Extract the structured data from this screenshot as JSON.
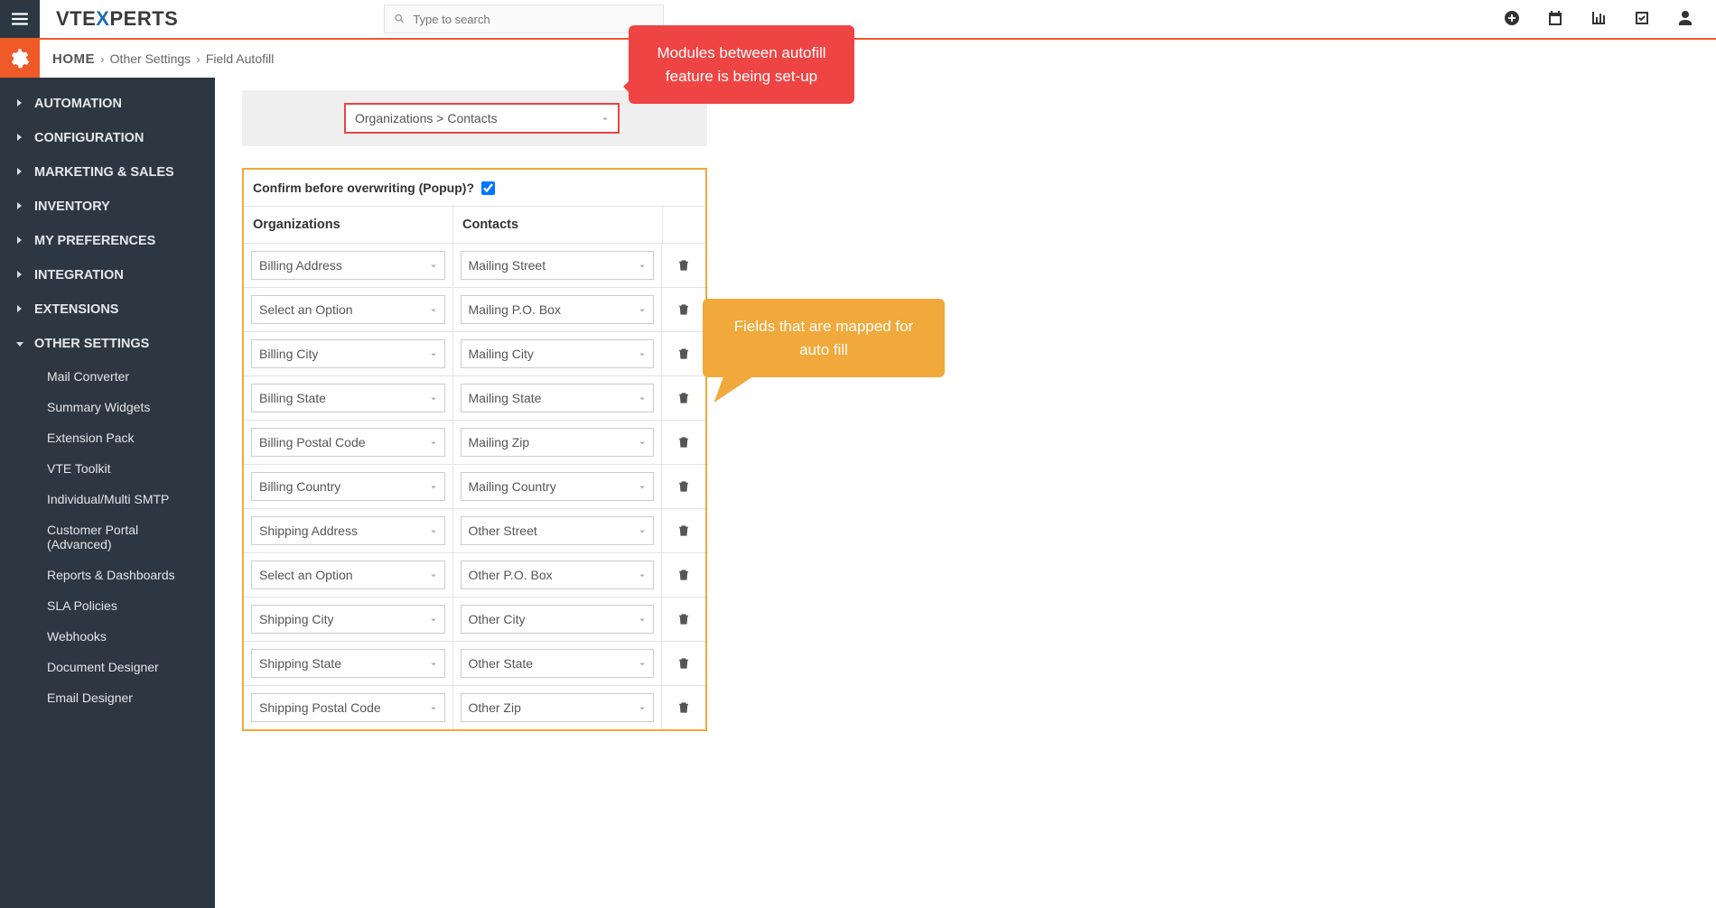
{
  "header": {
    "logo_pre": "VTE",
    "logo_x": "X",
    "logo_post": "PERTS",
    "search_placeholder": "Type to search"
  },
  "breadcrumb": {
    "home": "HOME",
    "mid": "Other Settings",
    "last": "Field Autofill"
  },
  "sidebar": {
    "items": [
      {
        "label": "AUTOMATION"
      },
      {
        "label": "CONFIGURATION"
      },
      {
        "label": "MARKETING & SALES"
      },
      {
        "label": "INVENTORY"
      },
      {
        "label": "MY PREFERENCES"
      },
      {
        "label": "INTEGRATION"
      },
      {
        "label": "EXTENSIONS"
      },
      {
        "label": "OTHER SETTINGS",
        "expanded": true
      }
    ],
    "subs": [
      {
        "label": "Mail Converter"
      },
      {
        "label": "Summary Widgets"
      },
      {
        "label": "Extension Pack"
      },
      {
        "label": "VTE Toolkit"
      },
      {
        "label": "Individual/Multi SMTP"
      },
      {
        "label": "Customer Portal (Advanced)"
      },
      {
        "label": "Reports & Dashboards"
      },
      {
        "label": "SLA Policies"
      },
      {
        "label": "Webhooks"
      },
      {
        "label": "Document Designer"
      },
      {
        "label": "Email Designer"
      }
    ]
  },
  "module_select": "Organizations > Contacts",
  "confirm_label": "Confirm before overwriting (Popup)?",
  "col1": "Organizations",
  "col2": "Contacts",
  "rows": [
    {
      "org": "Billing Address",
      "con": "Mailing Street"
    },
    {
      "org": "Select an Option",
      "con": "Mailing P.O. Box"
    },
    {
      "org": "Billing City",
      "con": "Mailing City"
    },
    {
      "org": "Billing State",
      "con": "Mailing State"
    },
    {
      "org": "Billing Postal Code",
      "con": "Mailing Zip"
    },
    {
      "org": "Billing Country",
      "con": "Mailing Country"
    },
    {
      "org": "Shipping Address",
      "con": "Other Street"
    },
    {
      "org": "Select an Option",
      "con": "Other P.O. Box"
    },
    {
      "org": "Shipping City",
      "con": "Other City"
    },
    {
      "org": "Shipping State",
      "con": "Other State"
    },
    {
      "org": "Shipping Postal Code",
      "con": "Other Zip"
    }
  ],
  "callout_red": "Modules between autofill feature is being set-up",
  "callout_orange": "Fields that are mapped for auto fill",
  "icons": {
    "hamburger": "menu-icon",
    "search": "search-icon",
    "plus": "plus-circle-icon",
    "calendar": "calendar-icon",
    "chart": "bar-chart-icon",
    "check": "check-box-icon",
    "user": "user-icon",
    "gear": "gear-icon",
    "trash": "trash-icon",
    "caret": "caret-down-icon",
    "chevron": "chevron-right-icon"
  }
}
